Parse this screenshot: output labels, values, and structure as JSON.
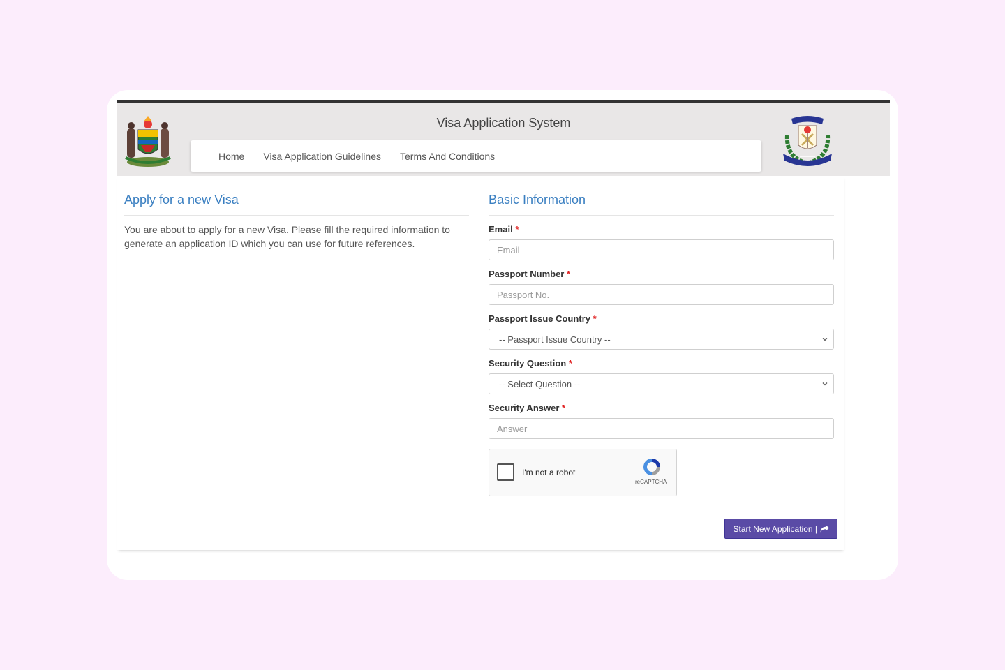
{
  "header": {
    "title": "Visa Application System",
    "left_logo": "coat-of-arms-icon",
    "right_logo": "immigration-emblem-icon"
  },
  "nav": {
    "items": [
      {
        "label": "Home"
      },
      {
        "label": "Visa Application Guidelines"
      },
      {
        "label": "Terms And Conditions"
      }
    ]
  },
  "intro": {
    "title": "Apply for a new Visa",
    "text": "You are about to apply for a new Visa. Please fill the required information to generate an application ID which you can use for future references."
  },
  "form": {
    "title": "Basic Information",
    "required_mark": "*",
    "email": {
      "label": "Email",
      "placeholder": "Email",
      "value": ""
    },
    "passport_number": {
      "label": "Passport Number",
      "placeholder": "Passport No.",
      "value": ""
    },
    "passport_country": {
      "label": "Passport Issue Country",
      "selected": "-- Passport Issue Country --"
    },
    "security_question": {
      "label": "Security Question",
      "selected": "-- Select Question --"
    },
    "security_answer": {
      "label": "Security Answer",
      "placeholder": "Answer",
      "value": ""
    },
    "captcha": {
      "label": "I'm not a robot",
      "brand": "reCAPTCHA",
      "checked": false
    },
    "submit_label": "Start New Application |"
  },
  "colors": {
    "background": "#fcedfc",
    "header_bg": "#e9e7e7",
    "title_blue": "#3a7fc1",
    "button": "#5a4ba6",
    "required": "#e02020"
  }
}
